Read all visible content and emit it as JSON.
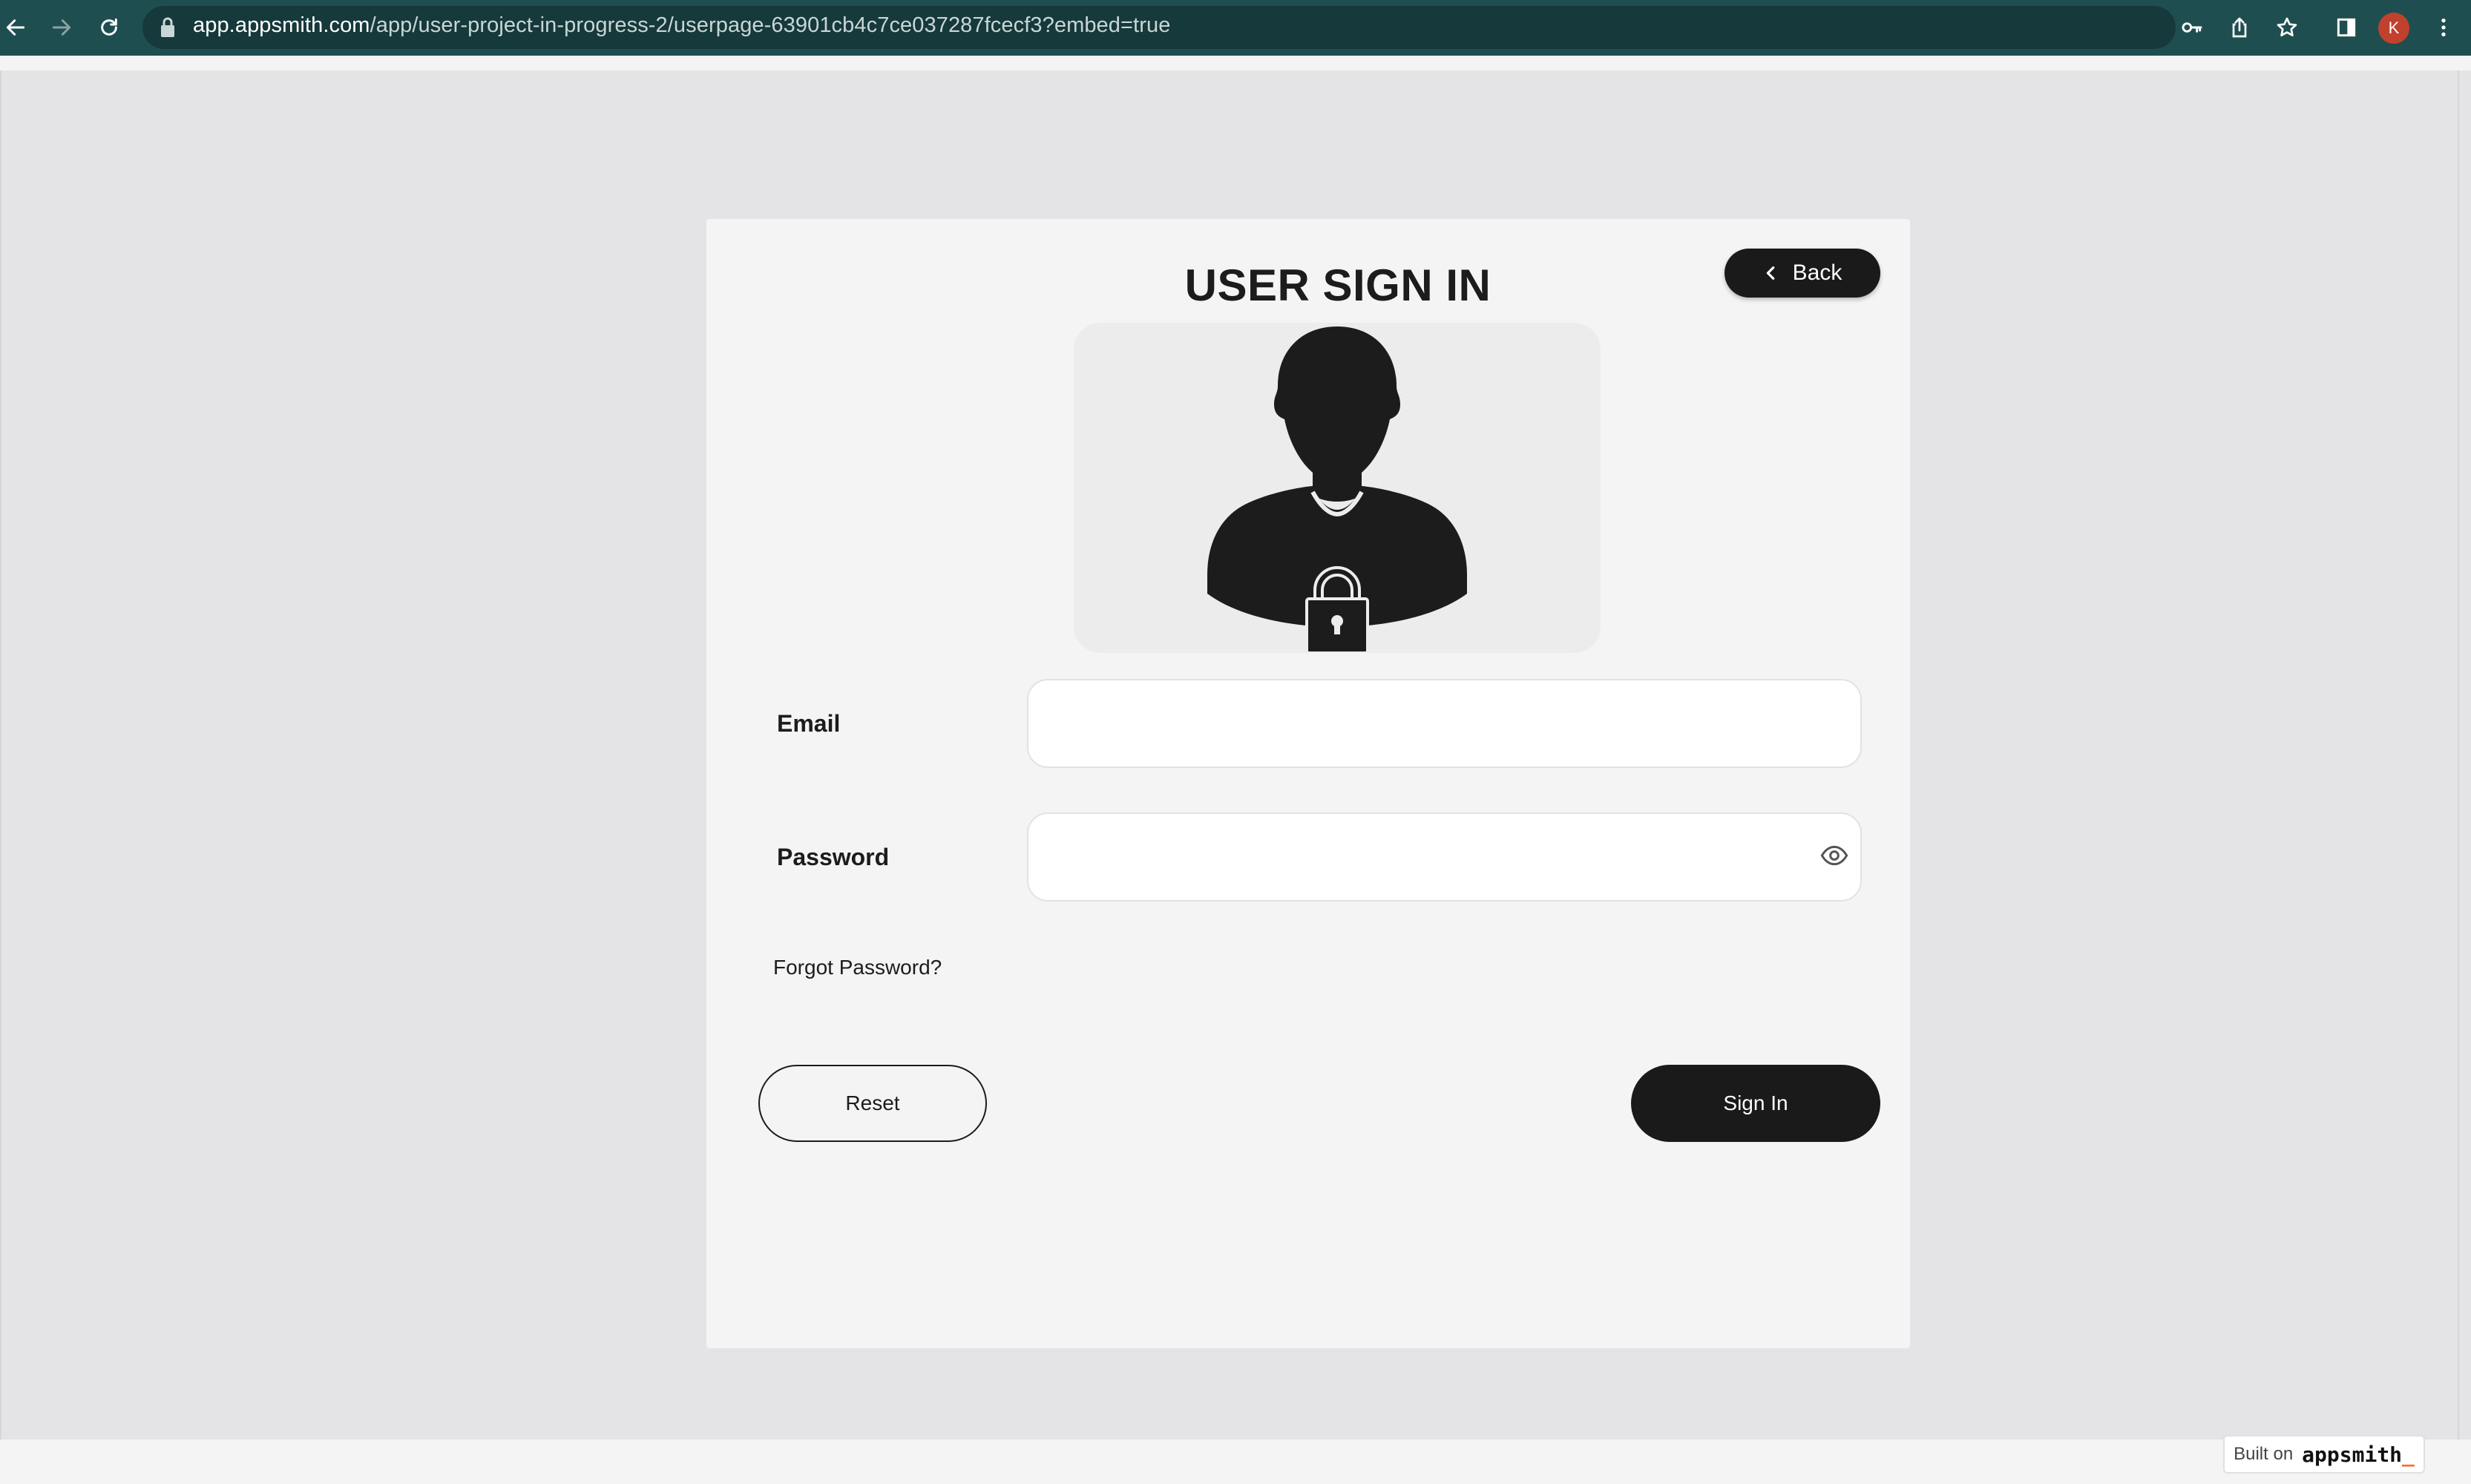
{
  "browser": {
    "url_host": "app.appsmith.com",
    "url_path": "/app/user-project-in-progress-2/userpage-63901cb4c7ce037287fcecf3?embed=true",
    "profile_initial": "K",
    "icons": [
      "back-arrow-icon",
      "forward-arrow-icon",
      "reload-icon",
      "lock-icon",
      "key-icon",
      "share-icon",
      "star-icon",
      "sidebar-icon",
      "kebab-menu-icon"
    ]
  },
  "form": {
    "title": "USER SIGN IN",
    "back_label": "Back",
    "email_label": "Email",
    "email_value": "",
    "password_label": "Password",
    "password_value": "",
    "forgot_label": "Forgot Password?",
    "reset_label": "Reset",
    "signin_label": "Sign In"
  },
  "footer": {
    "built_on": "Built on",
    "brand": "appsmith",
    "brand_suffix": "_"
  },
  "colors": {
    "browser_bar": "#1f4e50",
    "page_bg": "#e4e4e6",
    "card_bg": "#f4f4f4",
    "primary_button": "#1a1a1a",
    "avatar_profile": "#c2412c",
    "brand_accent": "#f86a2b"
  }
}
